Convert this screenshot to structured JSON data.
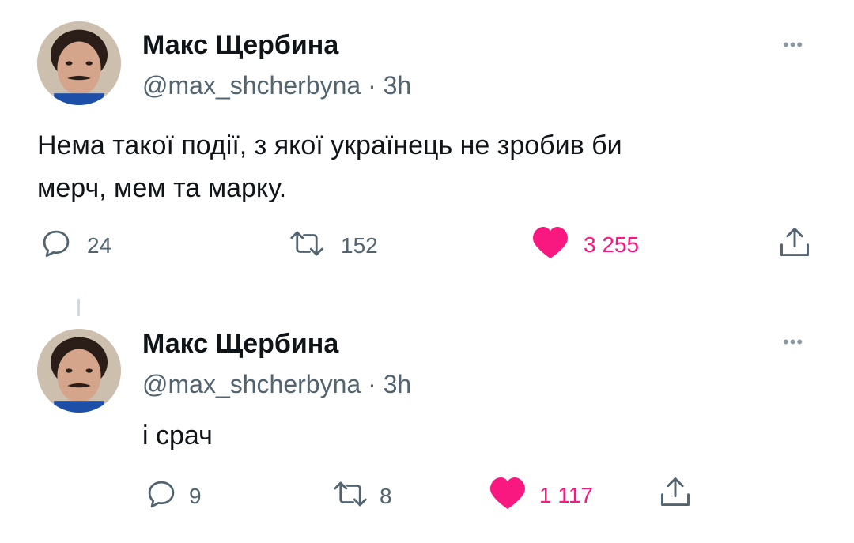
{
  "tweets": [
    {
      "author_name": "Макс Щербина",
      "handle": "@max_shcherbyna",
      "separator": "·",
      "time": "3h",
      "text_line1": "Нема такої події, з якої українець не зробив би",
      "text_line2": "мерч, мем та марку.",
      "more_glyph": "•••",
      "replies": "24",
      "retweets": "152",
      "likes": "3 255",
      "liked": true
    },
    {
      "author_name": "Макс Щербина",
      "handle": "@max_shcherbyna",
      "separator": "·",
      "time": "3h",
      "text_line1": "і срач",
      "more_glyph": "•••",
      "replies": "9",
      "retweets": "8",
      "likes": "1 117",
      "liked": true
    }
  ],
  "icons": {
    "reply": "reply-icon",
    "retweet": "retweet-icon",
    "like": "heart-icon",
    "share": "share-icon",
    "more": "more-icon"
  },
  "colors": {
    "like": "#f91880",
    "text": "#0f1419",
    "secondary": "#536471",
    "thread_line": "#cfd9de"
  }
}
